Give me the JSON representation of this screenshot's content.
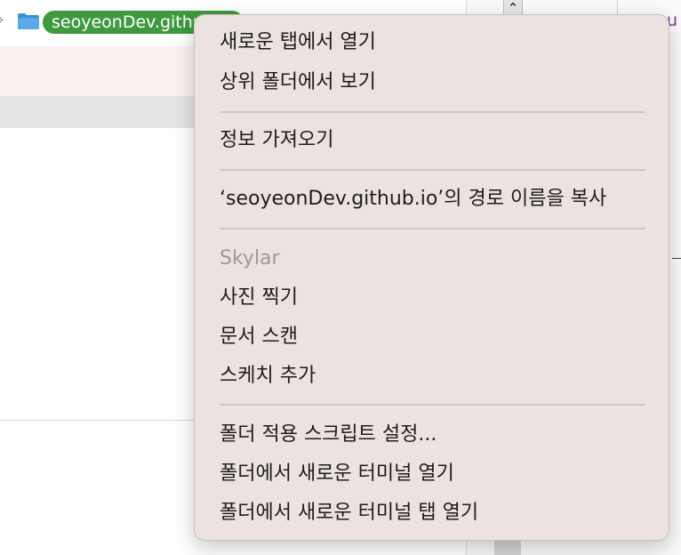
{
  "pathbar": {
    "chevron": "›",
    "folder_icon": "folder-icon",
    "folder_color": "#3a8fd6",
    "selected_folder": "seoyeonDev.github.io",
    "pill_color": "#3f9a3f"
  },
  "right_edge": {
    "scroll_glyph": "⌃",
    "partial_text": "u"
  },
  "context_menu": {
    "items": [
      {
        "label": "새로운 탭에서 열기"
      },
      {
        "label": "상위 폴더에서 보기"
      },
      {
        "label": "정보 가져오기"
      },
      {
        "label": "‘seoyeonDev.github.io’의 경로 이름을 복사"
      },
      {
        "label": "Skylar",
        "disabled": true
      },
      {
        "label": "사진 찍기"
      },
      {
        "label": "문서 스캔"
      },
      {
        "label": "스케치 추가"
      },
      {
        "label": "폴더 적용 스크립트 설정..."
      },
      {
        "label": "폴더에서 새로운 터미널 열기"
      },
      {
        "label": "폴더에서 새로운 터미널 탭 열기"
      }
    ]
  }
}
